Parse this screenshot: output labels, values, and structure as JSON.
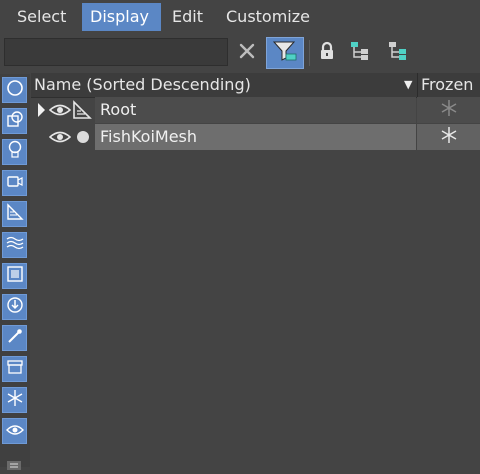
{
  "menu": {
    "items": [
      {
        "label": "Select"
      },
      {
        "label": "Display"
      },
      {
        "label": "Edit"
      },
      {
        "label": "Customize"
      }
    ],
    "active": "Display"
  },
  "toolbar": {
    "search": {
      "value": "",
      "placeholder": ""
    },
    "icons": [
      "clear-icon",
      "filter-icon",
      "lock-icon",
      "hierarchy-icon",
      "hierarchy-alt-icon"
    ]
  },
  "left_toolbar": {
    "icons": [
      "sphere-icon",
      "shapes-icon",
      "light-bulb-icon",
      "camera-icon",
      "helper-icon",
      "spacewarp-icon",
      "group-icon",
      "xref-icon",
      "bone-icon",
      "container-icon",
      "frozen-icon",
      "visibility-icon"
    ]
  },
  "table": {
    "columns": {
      "name": "Name (Sorted Descending)",
      "frozen": "Frozen"
    },
    "rows": [
      {
        "name": "Root",
        "expanded": false,
        "visible": true,
        "frozen": false
      },
      {
        "name": "FishKoiMesh",
        "expanded": false,
        "visible": true,
        "frozen": false,
        "selected": true
      }
    ]
  },
  "colors": {
    "accent": "#5b87c5",
    "background": "#444444",
    "selected_row": "#6e6e6e"
  }
}
